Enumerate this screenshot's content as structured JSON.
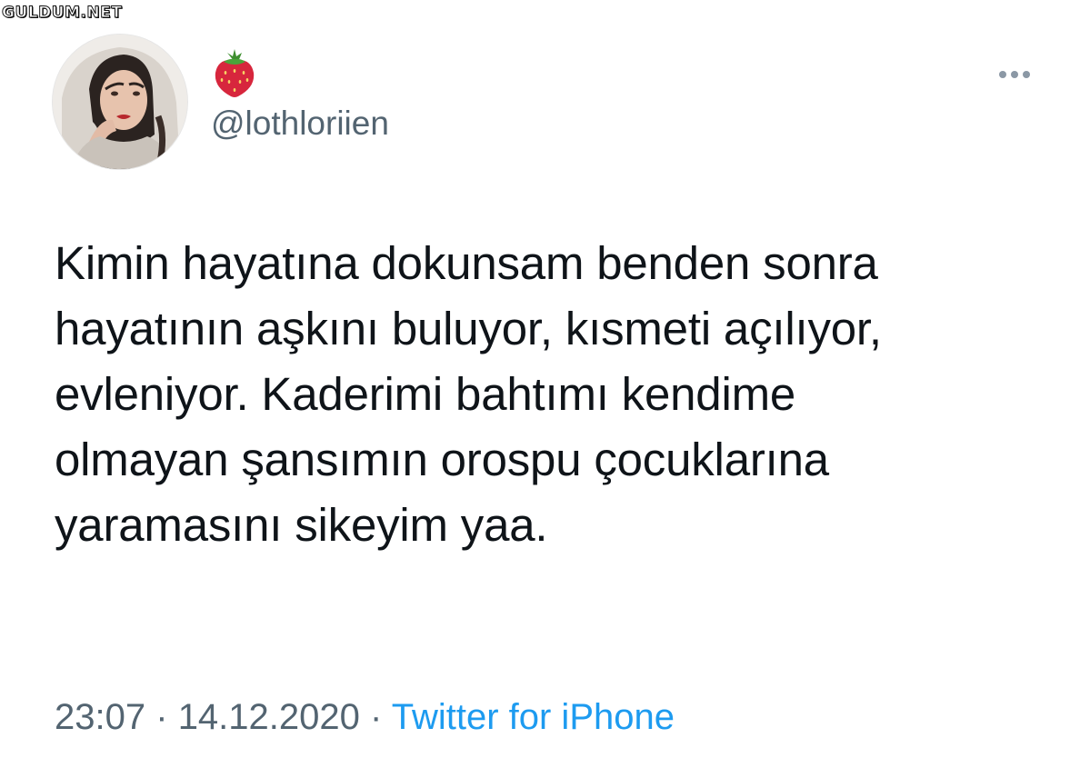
{
  "watermark": "GULDUM.NET",
  "author": {
    "display_name_icon": "strawberry-emoji",
    "handle": "@lothloriien"
  },
  "tweet": {
    "lines": [
      "Kimin hayatına dokunsam benden sonra",
      "hayatının aşkını buluyor, kısmeti açılıyor,",
      "evleniyor. Kaderimi bahtımı kendime",
      "olmayan şansımın orospu çocuklarına",
      "yaramasını sikeyim yaa."
    ]
  },
  "meta": {
    "time": "23:07",
    "separator": "·",
    "date": "14.12.2020",
    "source": "Twitter for iPhone"
  },
  "colors": {
    "text": "#0f1419",
    "secondary": "#536471",
    "link": "#1d9bf0"
  }
}
